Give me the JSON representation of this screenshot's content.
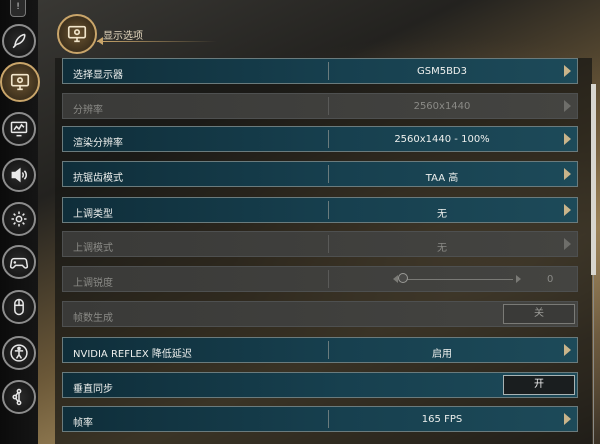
{
  "header": {
    "title": "显示选项"
  },
  "sidebar": {
    "top_tab_icon": "exclamation-icon",
    "items": [
      {
        "name": "nav-gameplay",
        "icon": "feather-icon"
      },
      {
        "name": "nav-display",
        "icon": "monitor-icon",
        "active": true
      },
      {
        "name": "nav-graphics",
        "icon": "chart-monitor-icon"
      },
      {
        "name": "nav-audio",
        "icon": "speaker-icon"
      },
      {
        "name": "nav-settings",
        "icon": "gear-icon"
      },
      {
        "name": "nav-controller",
        "icon": "gamepad-icon"
      },
      {
        "name": "nav-mouse",
        "icon": "mouse-icon"
      },
      {
        "name": "nav-accessibility",
        "icon": "accessibility-icon"
      },
      {
        "name": "nav-network",
        "icon": "network-icon"
      }
    ]
  },
  "settings": [
    {
      "id": "select-display",
      "label": "选择显示器",
      "value": "GSM5BD3",
      "kind": "select",
      "disabled": false
    },
    {
      "id": "resolution",
      "label": "分辨率",
      "value": "2560x1440",
      "kind": "select",
      "disabled": true
    },
    {
      "id": "render-resolution",
      "label": "渲染分辨率",
      "value": "2560x1440 - 100%",
      "kind": "select",
      "disabled": false
    },
    {
      "id": "anti-aliasing",
      "label": "抗锯齿模式",
      "value": "TAA 高",
      "kind": "select",
      "disabled": false
    },
    {
      "id": "upscale-type",
      "label": "上调类型",
      "value": "无",
      "kind": "select",
      "disabled": false
    },
    {
      "id": "upscale-mode",
      "label": "上调模式",
      "value": "无",
      "kind": "select",
      "disabled": true
    },
    {
      "id": "upscale-sharpness",
      "label": "上调锐度",
      "value": "0",
      "kind": "slider",
      "level": 0,
      "disabled": true
    },
    {
      "id": "frame-generation",
      "label": "帧数生成",
      "value": "关",
      "kind": "toggle",
      "disabled": true
    },
    {
      "id": "nvidia-reflex",
      "label": "NVIDIA REFLEX 降低延迟",
      "value": "启用",
      "kind": "select",
      "disabled": false
    },
    {
      "id": "vsync",
      "label": "垂直同步",
      "value": "开",
      "kind": "toggle",
      "disabled": false
    },
    {
      "id": "frame-rate",
      "label": "帧率",
      "value": "165 FPS",
      "kind": "select",
      "disabled": false
    }
  ],
  "scrollbar": {
    "position": 0.0,
    "visible_fraction": 0.53
  }
}
